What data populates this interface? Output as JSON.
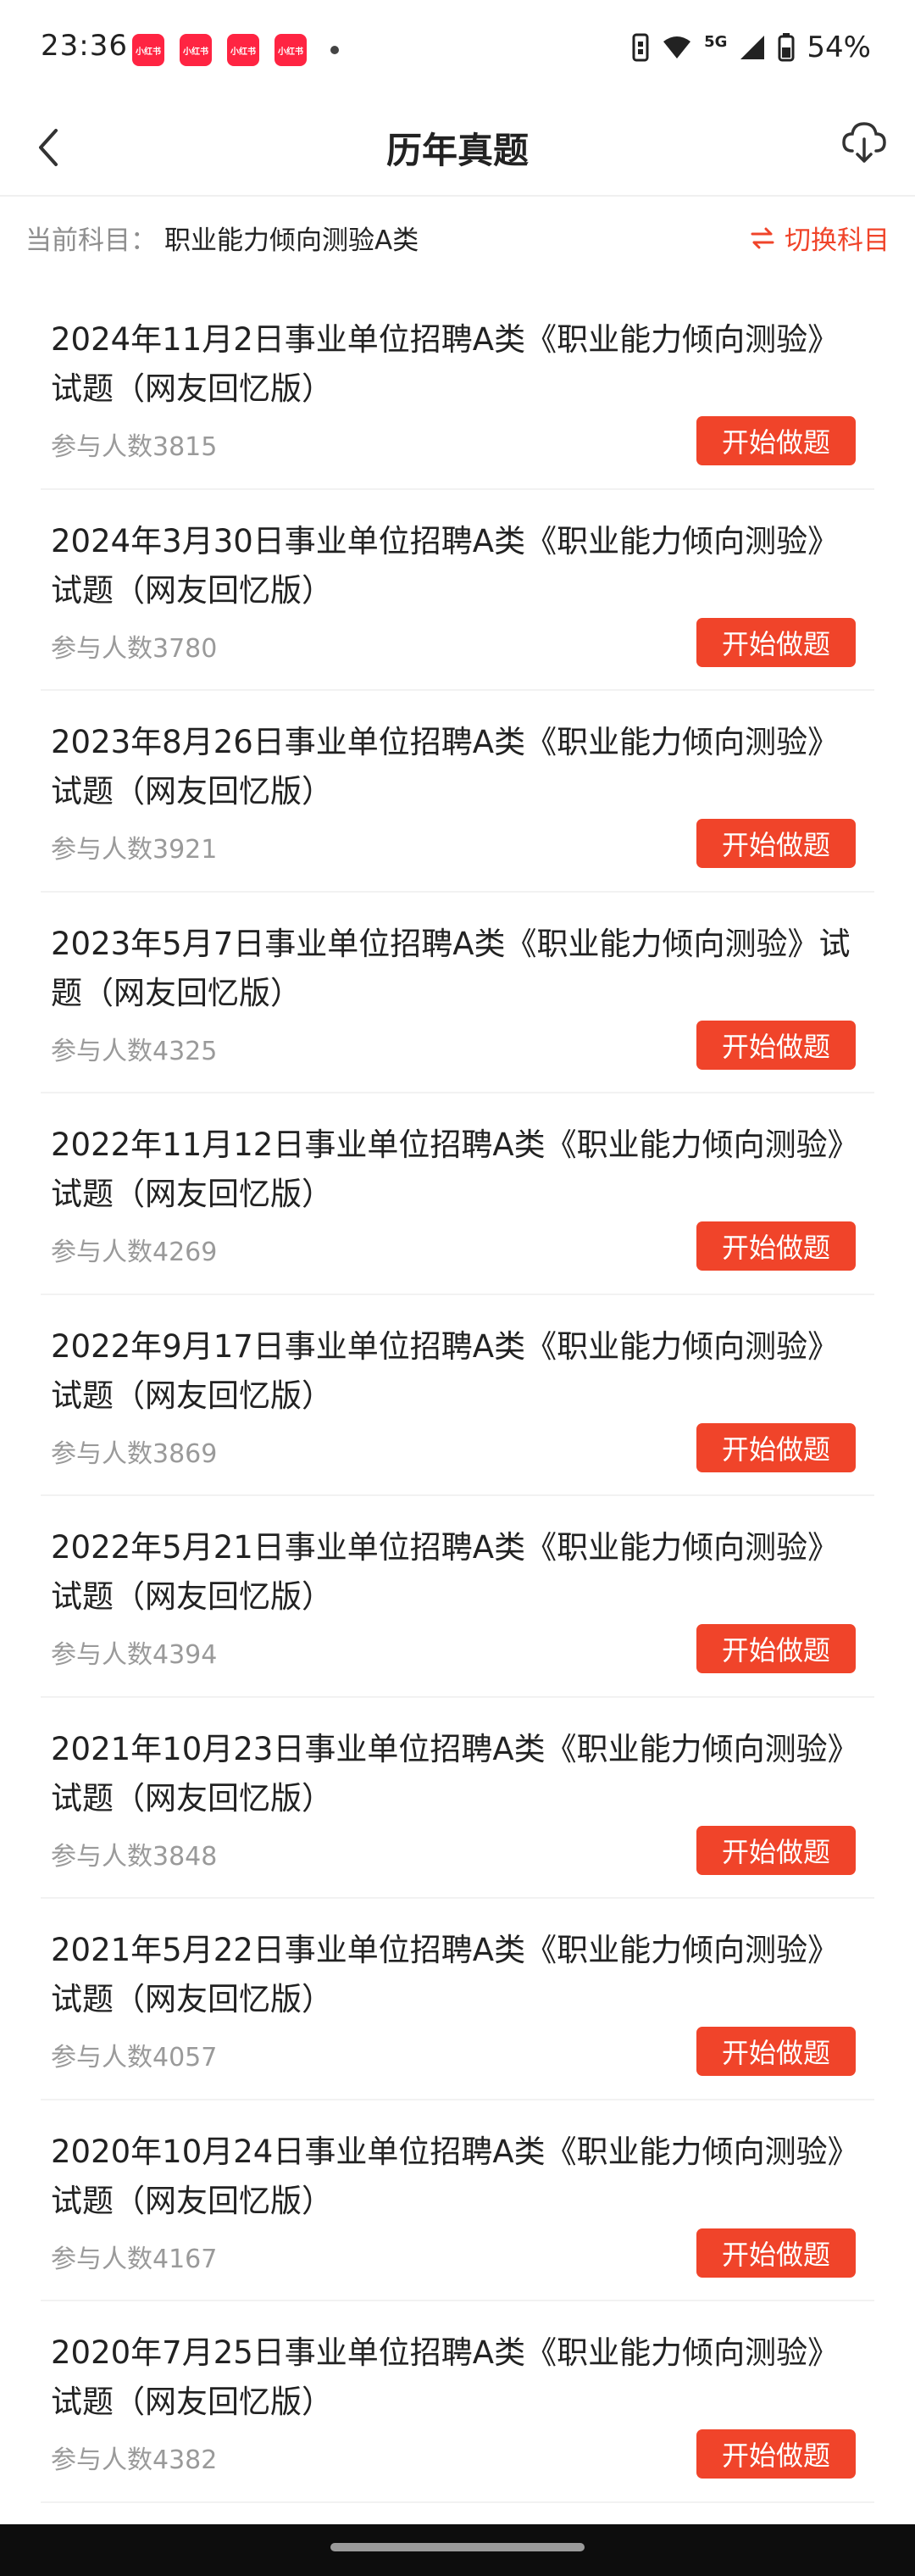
{
  "status_bar": {
    "time": "23:36",
    "notif_label": "小红书",
    "network": "5G",
    "battery": "54%"
  },
  "header": {
    "title": "历年真题"
  },
  "subject": {
    "label": "当前科目：",
    "value": "职业能力倾向测验A类",
    "switch_label": "切换科目"
  },
  "exams": [
    {
      "title": "2024年11月2日事业单位招聘A类《职业能力倾向测验》试题（网友回忆版）",
      "count": "参与人数3815",
      "button": "开始做题"
    },
    {
      "title": "2024年3月30日事业单位招聘A类《职业能力倾向测验》试题（网友回忆版）",
      "count": "参与人数3780",
      "button": "开始做题"
    },
    {
      "title": "2023年8月26日事业单位招聘A类《职业能力倾向测验》试题（网友回忆版）",
      "count": "参与人数3921",
      "button": "开始做题"
    },
    {
      "title": "2023年5月7日事业单位招聘A类《职业能力倾向测验》试题（网友回忆版）",
      "count": "参与人数4325",
      "button": "开始做题"
    },
    {
      "title": "2022年11月12日事业单位招聘A类《职业能力倾向测验》试题（网友回忆版）",
      "count": "参与人数4269",
      "button": "开始做题"
    },
    {
      "title": "2022年9月17日事业单位招聘A类《职业能力倾向测验》试题（网友回忆版）",
      "count": "参与人数3869",
      "button": "开始做题"
    },
    {
      "title": "2022年5月21日事业单位招聘A类《职业能力倾向测验》试题（网友回忆版）",
      "count": "参与人数4394",
      "button": "开始做题"
    },
    {
      "title": "2021年10月23日事业单位招聘A类《职业能力倾向测验》试题（网友回忆版）",
      "count": "参与人数3848",
      "button": "开始做题"
    },
    {
      "title": "2021年5月22日事业单位招聘A类《职业能力倾向测验》试题（网友回忆版）",
      "count": "参与人数4057",
      "button": "开始做题"
    },
    {
      "title": "2020年10月24日事业单位招聘A类《职业能力倾向测验》试题（网友回忆版）",
      "count": "参与人数4167",
      "button": "开始做题"
    },
    {
      "title": "2020年7月25日事业单位招聘A类《职业能力倾向测验》试题（网友回忆版）",
      "count": "参与人数4382",
      "button": "开始做题"
    }
  ],
  "colors": {
    "accent": "#f0442a",
    "notif": "#ff2442"
  }
}
